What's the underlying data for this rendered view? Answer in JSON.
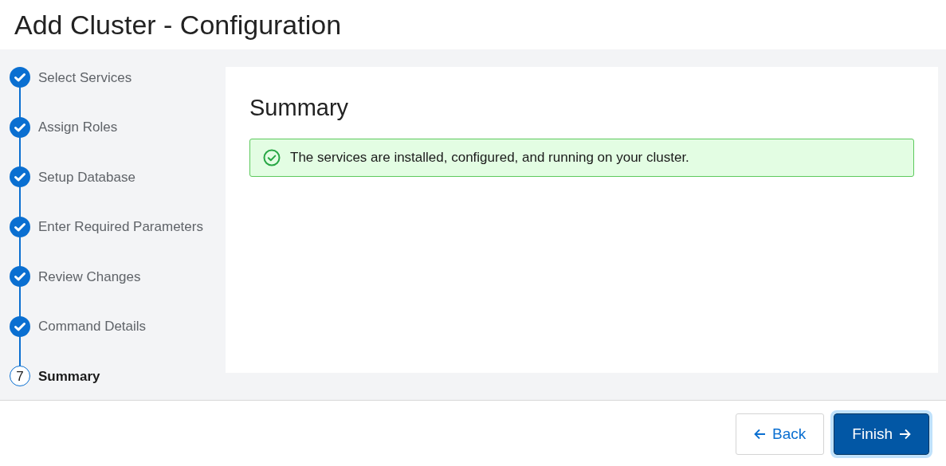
{
  "window": {
    "title": "Add Cluster - Configuration"
  },
  "steps": [
    {
      "label": "Select Services",
      "kind": "completed"
    },
    {
      "label": "Assign Roles",
      "kind": "completed"
    },
    {
      "label": "Setup Database",
      "kind": "completed"
    },
    {
      "label": "Enter Required Parameters",
      "kind": "completed"
    },
    {
      "label": "Review Changes",
      "kind": "completed"
    },
    {
      "label": "Command Details",
      "kind": "completed"
    },
    {
      "label": "Summary",
      "kind": "current",
      "number": "7"
    }
  ],
  "panel": {
    "heading": "Summary",
    "alert": {
      "kind": "success",
      "message": "The services are installed, configured, and running on your cluster."
    }
  },
  "footer": {
    "buttons": [
      {
        "label": "Back",
        "kind": "back"
      },
      {
        "label": "Finish",
        "kind": "finish"
      }
    ]
  }
}
